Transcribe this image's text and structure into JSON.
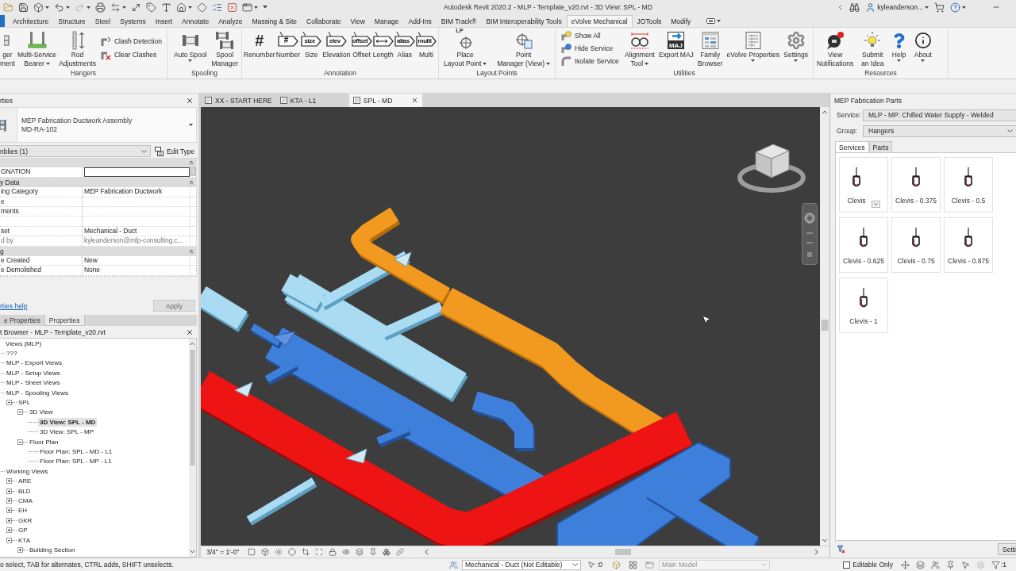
{
  "title_bar": {
    "title": "Autodesk Revit 2020.2 - MLP - Template_v20.rvt - 3D View: SPL - MD",
    "user": "kyleanderson..."
  },
  "ribbon_tabs": [
    {
      "label": "Architecture",
      "selected": false
    },
    {
      "label": "Structure",
      "selected": false
    },
    {
      "label": "Steel",
      "selected": false
    },
    {
      "label": "Systems",
      "selected": false
    },
    {
      "label": "Insert",
      "selected": false
    },
    {
      "label": "Annotate",
      "selected": false
    },
    {
      "label": "Analyze",
      "selected": false
    },
    {
      "label": "Massing & Site",
      "selected": false
    },
    {
      "label": "Collaborate",
      "selected": false
    },
    {
      "label": "View",
      "selected": false
    },
    {
      "label": "Manage",
      "selected": false
    },
    {
      "label": "Add-Ins",
      "selected": false
    },
    {
      "label": "BIM Track®",
      "selected": false
    },
    {
      "label": "BIM Interoperability Tools",
      "selected": false
    },
    {
      "label": "eVolve Mechanical",
      "selected": true
    },
    {
      "label": "JOTools",
      "selected": false
    },
    {
      "label": "Modify",
      "selected": false
    }
  ],
  "ribbon_panels": [
    {
      "title": "Hangers",
      "tools": [
        {
          "kind": "large",
          "lines": [
            "ger",
            "ment"
          ],
          "dropdown": false
        },
        {
          "kind": "large",
          "lines": [
            "Multi-Service",
            "Bearer"
          ],
          "dropdown": true
        },
        {
          "kind": "large",
          "lines": [
            "Rod",
            "Adjustments"
          ],
          "dropdown": false
        },
        {
          "kind": "small",
          "lines": [
            "Clash Detection"
          ],
          "dropdown": false
        },
        {
          "kind": "small",
          "lines": [
            "Clear Clashes"
          ],
          "dropdown": false
        }
      ]
    },
    {
      "title": "Spooling",
      "tools": [
        {
          "kind": "large",
          "lines": [
            "Auto Spool"
          ],
          "dropdown": true
        },
        {
          "kind": "large",
          "lines": [
            "Spool",
            "Manager"
          ],
          "dropdown": false
        }
      ]
    },
    {
      "title": "Annotation",
      "tools": [
        {
          "kind": "large",
          "lines": [
            "Renumber"
          ],
          "icon_text": "#",
          "dropdown": false
        },
        {
          "kind": "large",
          "lines": [
            "Number"
          ],
          "icon_text": "#",
          "dropdown": false
        },
        {
          "kind": "large",
          "lines": [
            "Size"
          ],
          "icon_text": "size",
          "dropdown": false
        },
        {
          "kind": "large",
          "lines": [
            "Elevation"
          ],
          "icon_text": "elev",
          "dropdown": false
        },
        {
          "kind": "large",
          "lines": [
            "Offset"
          ],
          "icon_text": "offset",
          "dropdown": false
        },
        {
          "kind": "large",
          "lines": [
            "Length"
          ],
          "dropdown": false
        },
        {
          "kind": "large",
          "lines": [
            "Alias"
          ],
          "icon_text": "alias",
          "dropdown": false
        },
        {
          "kind": "large",
          "lines": [
            "Multi"
          ],
          "icon_text": "multi",
          "dropdown": false
        }
      ]
    },
    {
      "title": "Layout Points",
      "tools": [
        {
          "kind": "large",
          "lines": [
            "Place",
            "Layout Point"
          ],
          "icon_text": "LP",
          "dropdown": true
        },
        {
          "kind": "large",
          "lines": [
            "Point",
            "Manager (View)"
          ],
          "dropdown": true
        }
      ]
    },
    {
      "title": "Utilities",
      "tools": [
        {
          "kind": "small",
          "lines": [
            "Show All"
          ],
          "dropdown": false
        },
        {
          "kind": "small",
          "lines": [
            "Hide Service"
          ],
          "dropdown": false
        },
        {
          "kind": "small",
          "lines": [
            "Isolate Service"
          ],
          "dropdown": false
        },
        {
          "kind": "large",
          "lines": [
            "Alignment",
            "Tool"
          ],
          "dropdown": true
        },
        {
          "kind": "large",
          "lines": [
            "Export MAJ"
          ],
          "icon_text": "MAJ",
          "dropdown": false
        },
        {
          "kind": "large",
          "lines": [
            "Family",
            "Browser"
          ],
          "dropdown": false
        },
        {
          "kind": "large",
          "lines": [
            "eVolve Properties"
          ],
          "dropdown": true
        },
        {
          "kind": "large",
          "lines": [
            "Settings"
          ],
          "dropdown": true
        }
      ]
    },
    {
      "title": "Resources",
      "tools": [
        {
          "kind": "large",
          "lines": [
            "View",
            "Notifications"
          ],
          "dropdown": false
        },
        {
          "kind": "large",
          "lines": [
            "Submit",
            "an Idea"
          ],
          "dropdown": false
        },
        {
          "kind": "large",
          "lines": [
            "Help"
          ],
          "dropdown": true
        },
        {
          "kind": "large",
          "lines": [
            "About"
          ],
          "dropdown": true
        }
      ]
    }
  ],
  "properties": {
    "title": "rties",
    "type": [
      "MEP Fabrication Ductwork Assembly",
      "MD-RA-102"
    ],
    "filter": "nblies (1)",
    "edit_type": "Edit Type",
    "rows": [
      {
        "kind": "group",
        "expanded": true
      },
      {
        "kind": "input",
        "label": "GNATION",
        "disabled": false
      },
      {
        "kind": "group",
        "label": "y Data",
        "expanded": true
      },
      {
        "kind": "field",
        "label": "ing Category",
        "value": "MEP Fabrication Ductwork",
        "disabled": false
      },
      {
        "kind": "field",
        "label": "e",
        "disabled": false
      },
      {
        "kind": "field",
        "label": "ments",
        "disabled": false
      },
      {
        "kind": "field"
      },
      {
        "kind": "field",
        "label": "set",
        "value": "Mechanical - Duct",
        "disabled": false
      },
      {
        "kind": "field",
        "label": "d by",
        "value": "kyleanderson@mlp-consulting.c...",
        "disabled": true
      },
      {
        "kind": "group",
        "label": "g",
        "expanded": true
      },
      {
        "kind": "field",
        "label": "e Created",
        "value": "New",
        "disabled": false
      },
      {
        "kind": "field",
        "label": "e Demolished",
        "value": "None",
        "disabled": false
      }
    ],
    "help_link": "rties help",
    "apply": {
      "label": "Apply",
      "disabled": true
    },
    "tabs": [
      {
        "label": "e Properties",
        "selected": false
      },
      {
        "label": "Properties",
        "selected": true
      }
    ]
  },
  "project_browser": {
    "title": "t Browser - MLP - Template_v20.rvt",
    "tree": [
      {
        "label": "Views (MLP)",
        "selected": false,
        "children": [
          {
            "label": "???",
            "selected": false
          },
          {
            "label": "MLP - Export Views",
            "selected": false
          },
          {
            "label": "MLP - Setup Views",
            "selected": false
          },
          {
            "label": "MLP - Sheet Views",
            "selected": false
          },
          {
            "label": "MLP - Spooling Views",
            "selected": false,
            "children": [
              {
                "label": "SPL",
                "expanded": true,
                "selected": false,
                "children": [
                  {
                    "label": "3D View",
                    "expanded": true,
                    "selected": false,
                    "children": [
                      {
                        "label": "3D View: SPL - MD",
                        "selected": true
                      },
                      {
                        "label": "3D View: SPL - MP",
                        "selected": false
                      }
                    ]
                  },
                  {
                    "label": "Floor Plan",
                    "expanded": true,
                    "selected": false,
                    "children": [
                      {
                        "label": "Floor Plan: SPL - MD - L1",
                        "selected": false
                      },
                      {
                        "label": "Floor Plan: SPL - MP - L1",
                        "selected": false
                      }
                    ]
                  }
                ]
              }
            ]
          },
          {
            "label": "Working Views",
            "selected": false,
            "children": [
              {
                "label": "ARE",
                "expanded": false,
                "selected": false
              },
              {
                "label": "BLD",
                "expanded": false,
                "selected": false
              },
              {
                "label": "CMA",
                "expanded": false,
                "selected": false
              },
              {
                "label": "EH",
                "expanded": false,
                "selected": false
              },
              {
                "label": "GKR",
                "expanded": false,
                "selected": false
              },
              {
                "label": "GP",
                "expanded": false,
                "selected": false
              },
              {
                "label": "KTA",
                "expanded": true,
                "selected": false,
                "children": [
                  {
                    "label": "Building Section",
                    "expanded": false,
                    "selected": false
                  }
                ]
              }
            ]
          }
        ]
      }
    ]
  },
  "view_tabs": [
    {
      "label": "XX - START HERE",
      "selected": false
    },
    {
      "label": "KTA - L1",
      "selected": false
    },
    {
      "label": "SPL - MD",
      "selected": true
    }
  ],
  "view_control_bar": {
    "scale": "3/4\" = 1'-0\""
  },
  "fabrication_parts": {
    "title": "MEP Fabrication Parts",
    "service_label": "Service:",
    "service": "MLP - MP: Chilled Water Supply - Welded",
    "group_label": "Group:",
    "group": "Hangers",
    "tabs": [
      {
        "label": "Services",
        "selected": true
      },
      {
        "label": "Parts",
        "selected": false
      }
    ],
    "parts": [
      {
        "label": "Clevis",
        "dropdown": true
      },
      {
        "label": "Clevis - 0.375",
        "dropdown": false
      },
      {
        "label": "Clevis - 0.5",
        "dropdown": false
      },
      {
        "label": "Clevis - 0.625",
        "dropdown": false
      },
      {
        "label": "Clevis - 0.75",
        "dropdown": false
      },
      {
        "label": "Clevis - 0.875",
        "dropdown": false
      },
      {
        "label": "Clevis - 1",
        "dropdown": false
      }
    ],
    "settings_button": "Setti"
  },
  "status_bar": {
    "hint": "o select, TAB for alternates, CTRL adds, SHIFT unselects.",
    "workset": "Mechanical - Duct (Not Editable)",
    "selection_count": ":0",
    "design_option": {
      "value": "Main Model",
      "disabled": true
    },
    "editable_only": {
      "label": "Editable Only",
      "checked": false
    },
    "filter_count": ":1"
  }
}
